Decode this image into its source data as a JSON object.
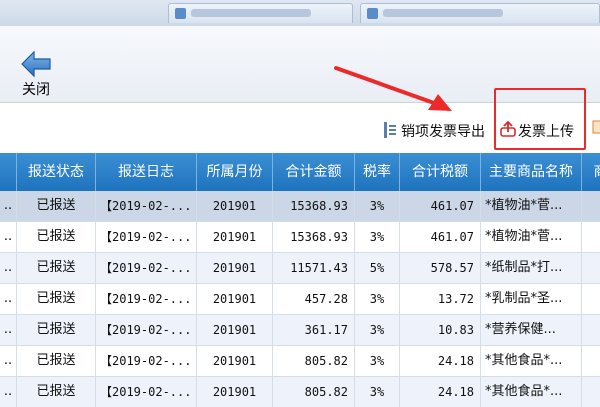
{
  "toolbar": {
    "close_label": "关闭"
  },
  "actions": {
    "export_label": "销项发票导出",
    "upload_label": "发票上传"
  },
  "table": {
    "columns": [
      "",
      "报送状态",
      "报送日志",
      "所属月份",
      "合计金额",
      "税率",
      "合计税额",
      "主要商品名称",
      "商"
    ],
    "rows": [
      {
        "lead": "..",
        "status": "已报送",
        "log": "【2019-02-...",
        "month": "201901",
        "amount": "15368.93",
        "rate": "3%",
        "tax": "461.07",
        "goods": "*植物油*菅...",
        "selected": true
      },
      {
        "lead": "..",
        "status": "已报送",
        "log": "【2019-02-...",
        "month": "201901",
        "amount": "15368.93",
        "rate": "3%",
        "tax": "461.07",
        "goods": "*植物油*菅..."
      },
      {
        "lead": "..",
        "status": "已报送",
        "log": "【2019-02-...",
        "month": "201901",
        "amount": "11571.43",
        "rate": "5%",
        "tax": "578.57",
        "goods": "*纸制品*打..."
      },
      {
        "lead": "..",
        "status": "已报送",
        "log": "【2019-02-...",
        "month": "201901",
        "amount": "457.28",
        "rate": "3%",
        "tax": "13.72",
        "goods": "*乳制品*圣..."
      },
      {
        "lead": "..",
        "status": "已报送",
        "log": "【2019-02-...",
        "month": "201901",
        "amount": "361.17",
        "rate": "3%",
        "tax": "10.83",
        "goods": "*营养保健..."
      },
      {
        "lead": "..",
        "status": "已报送",
        "log": "【2019-02-...",
        "month": "201901",
        "amount": "805.82",
        "rate": "3%",
        "tax": "24.18",
        "goods": "*其他食品*..."
      },
      {
        "lead": "..",
        "status": "已报送",
        "log": "【2019-02-...",
        "month": "201901",
        "amount": "805.82",
        "rate": "3%",
        "tax": "24.18",
        "goods": "*其他食品*..."
      }
    ]
  },
  "colors": {
    "header_bg": "#1e73be",
    "highlight": "#ec2a2a",
    "arrow": "#ec2a2a",
    "selected_row": "#cbd7e6"
  }
}
